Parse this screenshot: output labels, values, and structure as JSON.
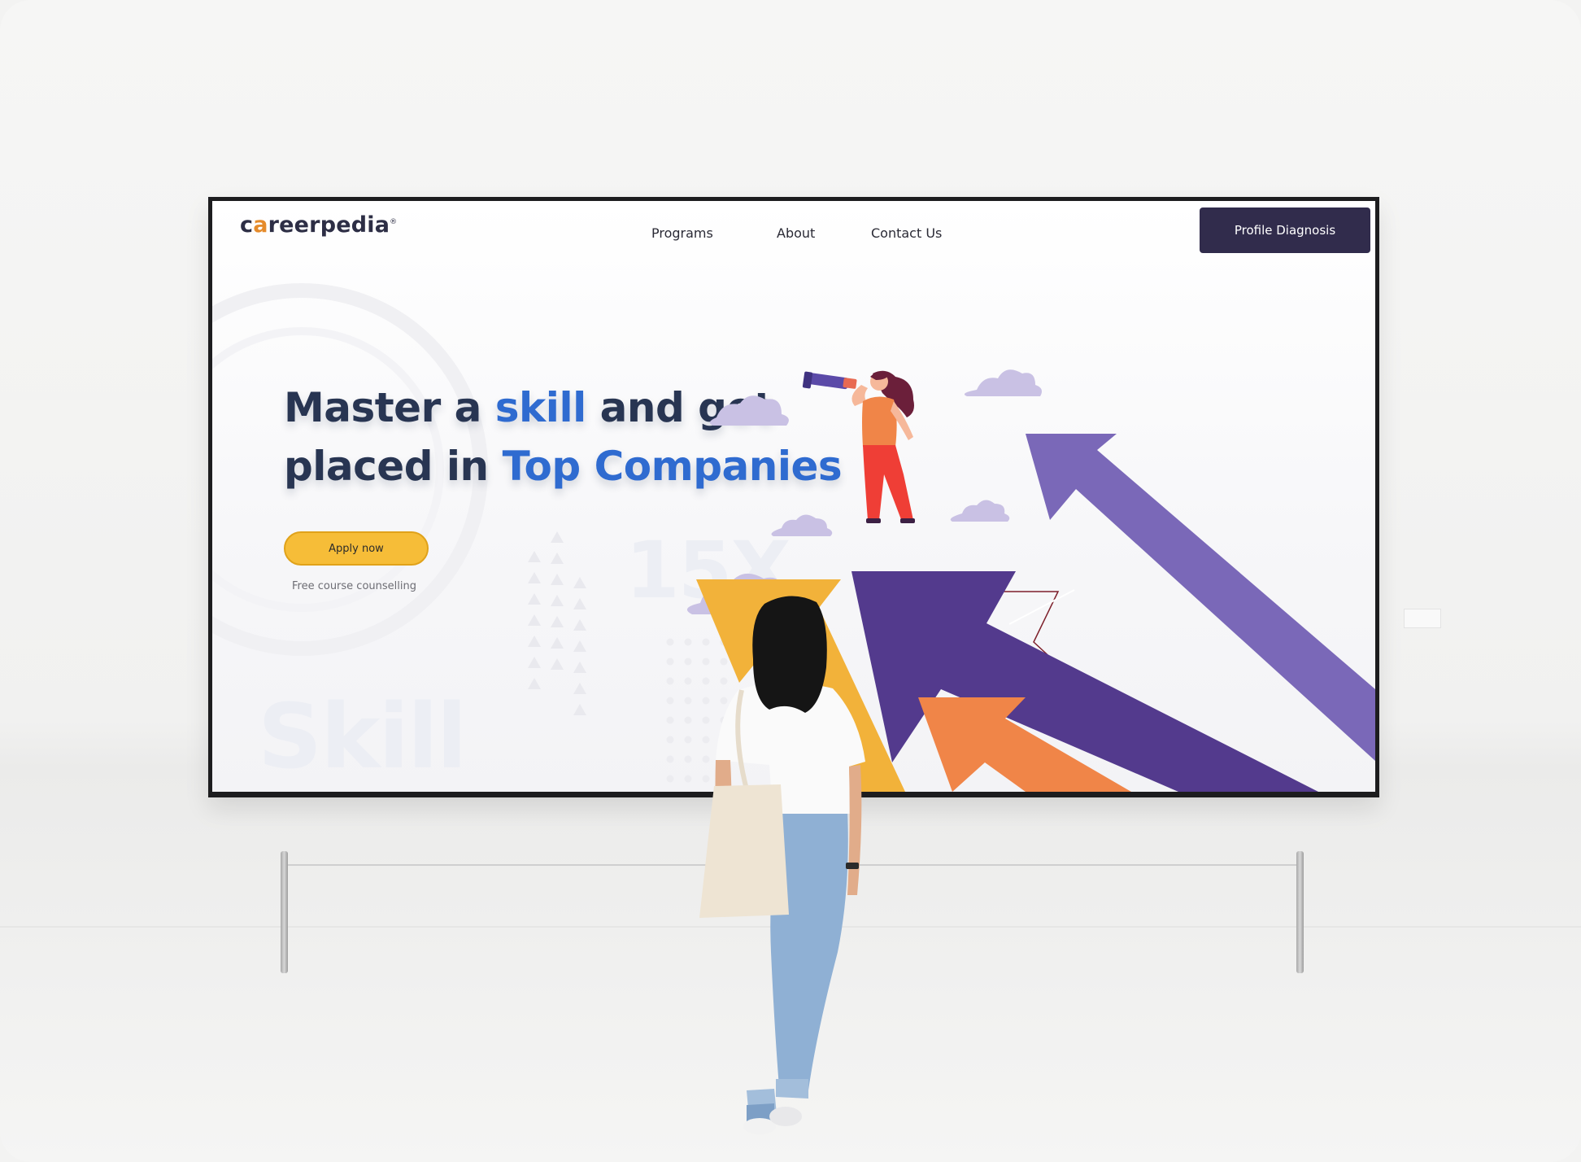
{
  "brand": {
    "logo_prefix": "c",
    "logo_accent": "a",
    "logo_suffix": "reerpedia",
    "logo_mark": "®"
  },
  "nav": {
    "programs": "Programs",
    "about": "About",
    "contact": "Contact Us"
  },
  "header_cta": "Profile Diagnosis",
  "hero": {
    "line1_part1": "Master a ",
    "line1_highlight": "skill",
    "line1_part2": " and get",
    "line2_part1": "placed in ",
    "line2_highlight": "Top Companies",
    "apply_label": "Apply now",
    "counselling_text": "Free course counselling"
  },
  "background_text": {
    "stat": "15X",
    "word": "Skill"
  },
  "colors": {
    "navy_text": "#283552",
    "highlight_blue": "#2f6bd0",
    "cta_dark": "#312c4c",
    "apply_yellow": "#f6bd38",
    "arrow_purple": "#533a8d",
    "arrow_light_purple": "#7a68b8",
    "arrow_orange": "#f08548",
    "arrow_yellow": "#f2b23a",
    "cloud_lilac": "#c9c1e4"
  },
  "icons": [
    "telescope-woman-illustration",
    "growth-arrows-illustration",
    "cloud-icon"
  ]
}
